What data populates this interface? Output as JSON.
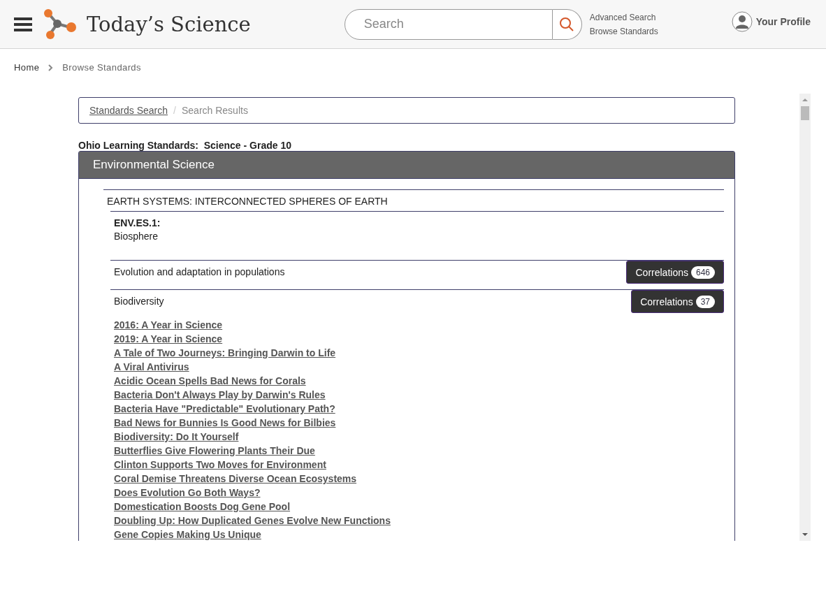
{
  "header": {
    "brand": "Today’s Science",
    "search": {
      "placeholder": "Search"
    },
    "links": [
      "Advanced Search",
      "Browse Standards"
    ],
    "profile": "Your Profile"
  },
  "breadcrumb": [
    "Home",
    "Browse Standards"
  ],
  "trail": {
    "link": "Standards Search",
    "separator": "/",
    "current": "Search Results"
  },
  "standard_title": "Ohio Learning Standards:  Science - Grade 10",
  "panel": {
    "title": "Environmental Science",
    "section": "EARTH SYSTEMS: INTERCONNECTED SPHERES OF EARTH",
    "code": "ENV.ES.1:",
    "name": "Biosphere",
    "topics": [
      {
        "title": "Evolution and adaptation in populations",
        "button": "Correlations",
        "count": "646"
      },
      {
        "title": "Biodiversity",
        "button": "Correlations",
        "count": "37",
        "articles": [
          "2016: A Year in Science",
          "2019: A Year in Science",
          "A Tale of Two Journeys: Bringing Darwin to Life",
          "A Viral Antivirus",
          "Acidic Ocean Spells Bad News for Corals",
          "Bacteria Don't Always Play by Darwin's Rules",
          "Bacteria Have \"Predictable\" Evolutionary Path?",
          "Bad News for Bunnies Is Good News for Bilbies",
          "Biodiversity: Do It Yourself",
          "Butterflies Give Flowering Plants Their Due",
          "Clinton Supports Two Moves for Environment",
          "Coral Demise Threatens Diverse Ocean Ecosystems",
          "Does Evolution Go Both Ways?",
          "Domestication Boosts Dog Gene Pool",
          "Doubling Up: How Duplicated Genes Evolve New Functions",
          "Gene Copies Making Us Unique"
        ]
      }
    ]
  }
}
